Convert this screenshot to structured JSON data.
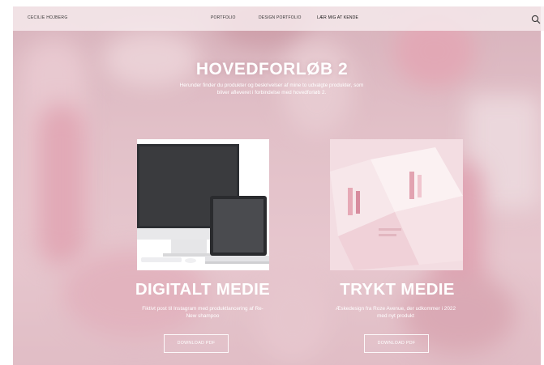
{
  "header": {
    "brand": "CECILIE HOJBERG",
    "nav": [
      {
        "label": "PORTFOLIO"
      },
      {
        "label": "DESIGN PORTFOLIO"
      },
      {
        "label": "LÆR MIG AT KENDE"
      }
    ],
    "search_icon": "search-icon"
  },
  "hero": {
    "title": "HOVEDFORLØB 2",
    "subtitle": "Herunder finder du produkter og beskrivelser af mine to udvalgte produkter, som bliver afleveret i forbindelse med hovedforløb 2."
  },
  "cards": [
    {
      "title": "DIGITALT MEDIE",
      "description": "Fiktivt post til Instagram med produktlancering af Re-New shampoo",
      "button": "DOWNLOAD PDF",
      "image": "laptop-and-monitor-mockup"
    },
    {
      "title": "TRYKT MEDIE",
      "description": "Æskedesign fra Roze Avenue, der udkommer i 2022 med nyt produkt",
      "button": "DOWNLOAD PDF",
      "image": "pink-brochure-mockup"
    }
  ],
  "colors": {
    "background_pink": "#e8cdd3",
    "text": "#ffffff",
    "nav_text": "#333333"
  }
}
